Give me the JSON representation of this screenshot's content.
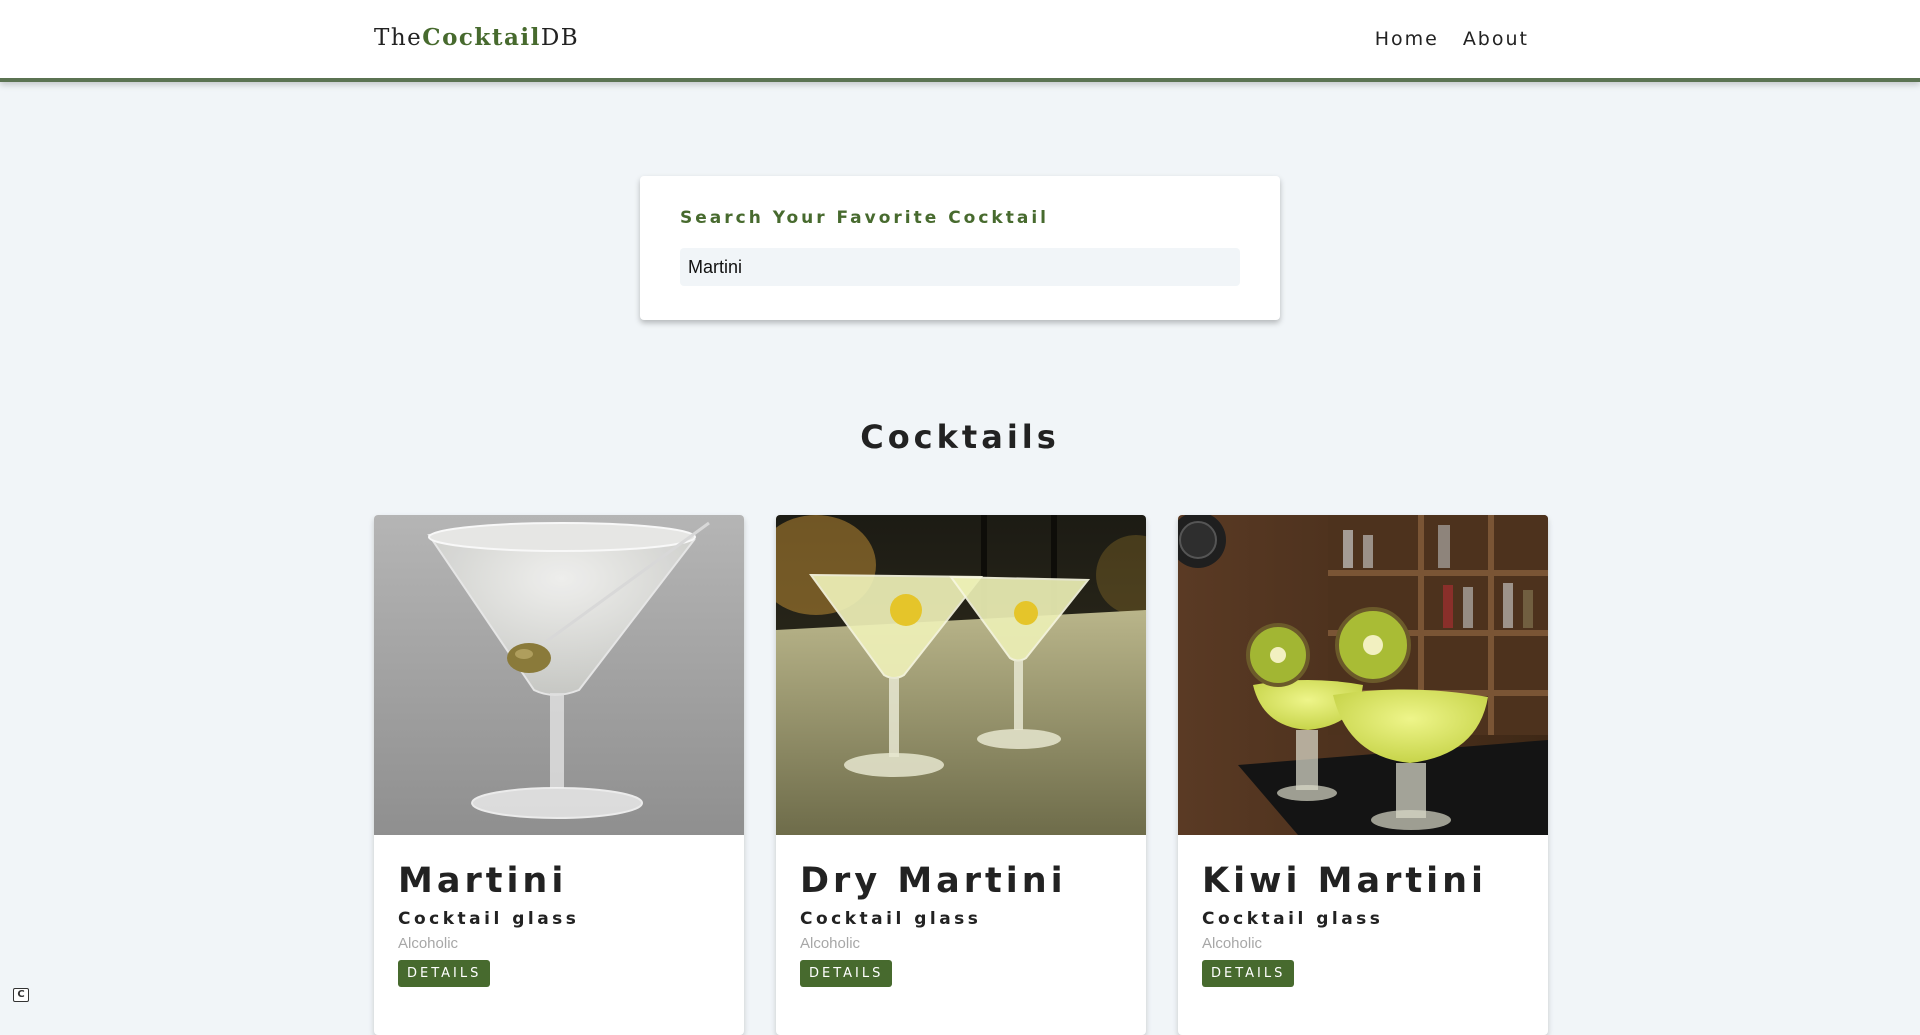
{
  "navbar": {
    "logo_prefix": "The",
    "logo_strong": "Cocktail",
    "logo_suffix": "DB",
    "links": [
      {
        "label": "Home"
      },
      {
        "label": "About"
      }
    ]
  },
  "search": {
    "label": "Search Your Favorite Cocktail",
    "value": "Martini"
  },
  "section_title": "Cocktails",
  "cocktails": [
    {
      "name": "Martini",
      "glass": "Cocktail glass",
      "info": "Alcoholic",
      "button": "DETAILS",
      "image": "martini-with-olive-photo"
    },
    {
      "name": "Dry Martini",
      "glass": "Cocktail glass",
      "info": "Alcoholic",
      "button": "DETAILS",
      "image": "two-dry-martinis-with-lemon-photo"
    },
    {
      "name": "Kiwi Martini",
      "glass": "Cocktail glass",
      "info": "Alcoholic",
      "button": "DETAILS",
      "image": "kiwi-martini-bar-photo"
    }
  ],
  "corner_badge": "C",
  "colors": {
    "primary": "#476a2e",
    "nav_border": "#5b7352",
    "background": "#f1f5f8",
    "muted_text": "#a7a7a7"
  }
}
